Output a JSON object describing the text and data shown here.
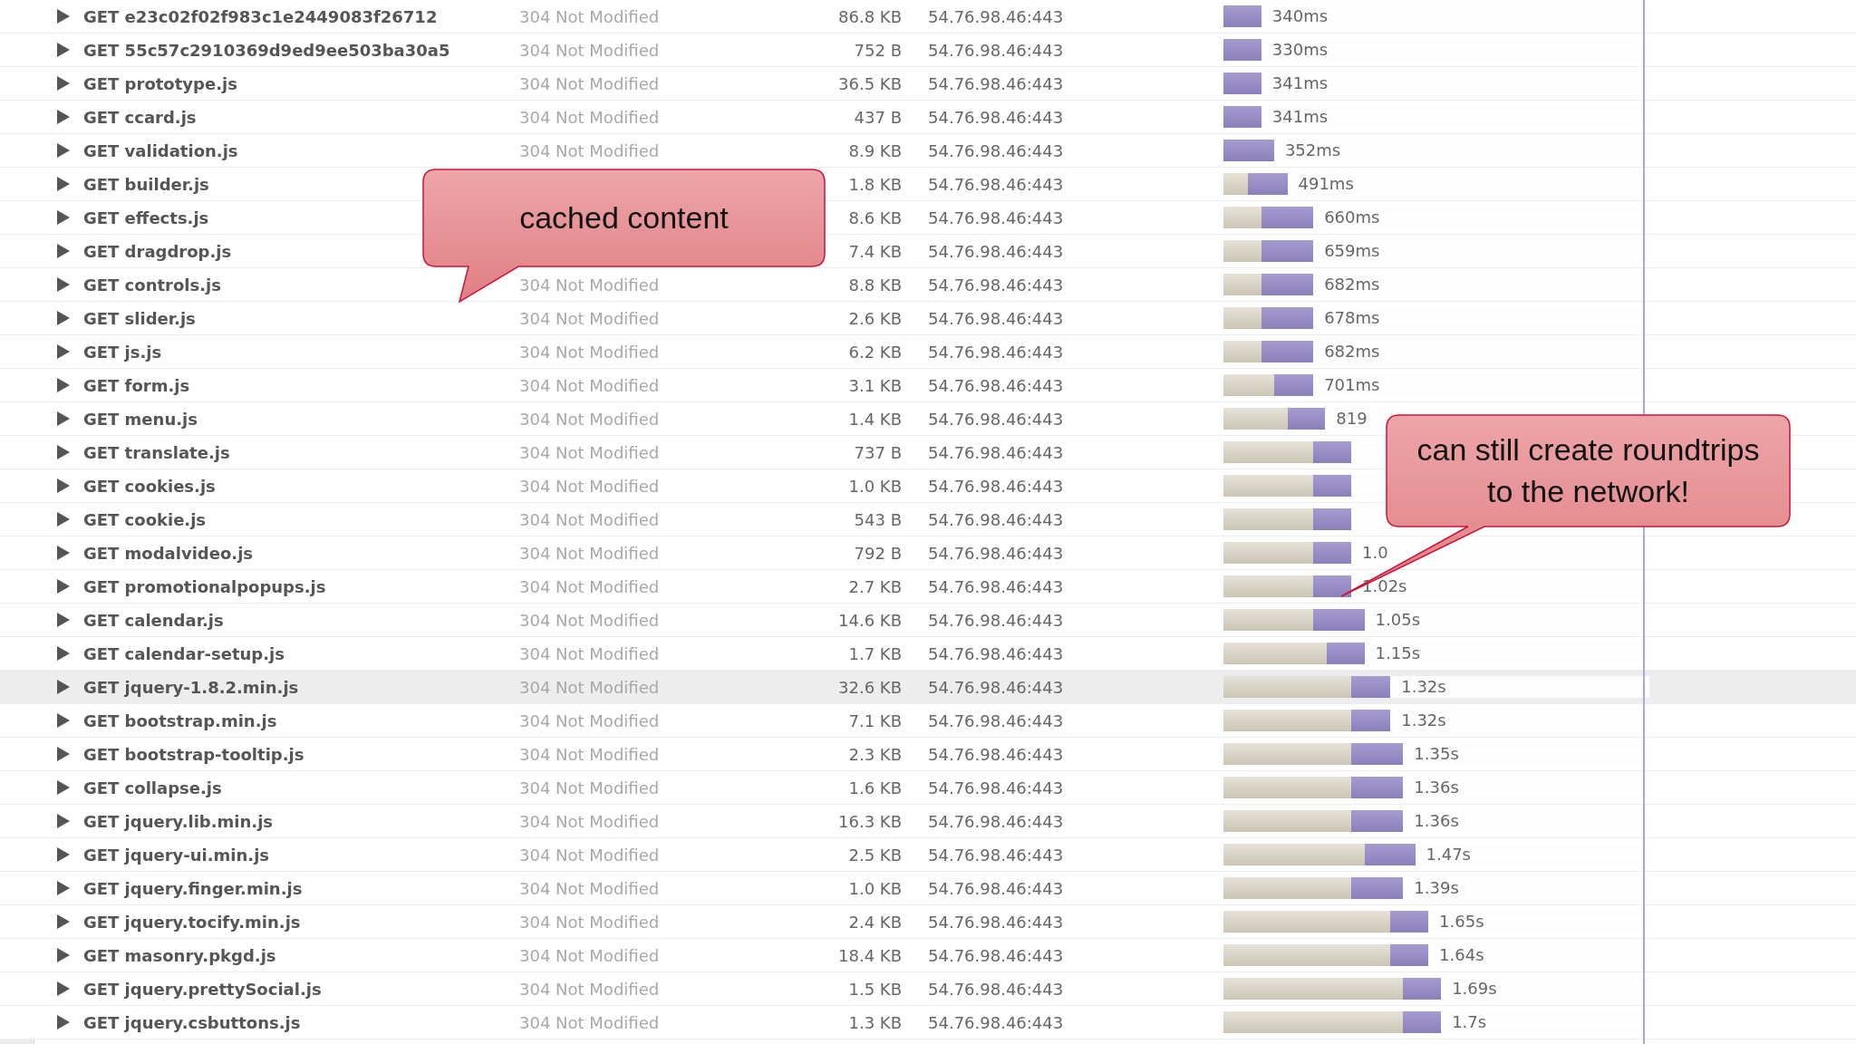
{
  "requests": [
    {
      "name": "GET e23c02f02f983c1e2449083f26712",
      "status": "304 Not Modified",
      "size": "86.8 KB",
      "remote": "54.76.98.46:443",
      "selected": false,
      "bar": {
        "level": 0.089
      },
      "time": "340ms"
    },
    {
      "name": "GET 55c57c2910369d9ed9ee503ba30a5",
      "status": "304 Not Modified",
      "size": "752 B",
      "remote": "54.76.98.46:443",
      "selected": false,
      "bar": {
        "level": 0.089
      },
      "time": "330ms"
    },
    {
      "name": "GET prototype.js",
      "status": "304 Not Modified",
      "size": "36.5 KB",
      "remote": "54.76.98.46:443",
      "selected": false,
      "bar": {
        "level": 0.089
      },
      "time": "341ms"
    },
    {
      "name": "GET ccard.js",
      "status": "304 Not Modified",
      "size": "437 B",
      "remote": "54.76.98.46:443",
      "selected": false,
      "bar": {
        "level": 0.089
      },
      "time": "341ms"
    },
    {
      "name": "GET validation.js",
      "status": "304 Not Modified",
      "size": "8.9 KB",
      "remote": "54.76.98.46:443",
      "selected": false,
      "bar": {
        "level": 0.119
      },
      "time": "352ms"
    },
    {
      "name": "GET builder.js",
      "size": "1.8 KB",
      "remote": "54.76.98.46:443",
      "selected": false,
      "wait": {
        "level": 0.058
      },
      "bar": {
        "level": 0.15
      },
      "time": "491ms"
    },
    {
      "name": "GET effects.js",
      "size": "8.6 KB",
      "remote": "54.76.98.46:443",
      "selected": false,
      "wait": {
        "level": 0.089
      },
      "bar": {
        "level": 0.211
      },
      "time": "660ms"
    },
    {
      "name": "GET dragdrop.js",
      "size": "7.4 KB",
      "remote": "54.76.98.46:443",
      "selected": false,
      "wait": {
        "level": 0.089
      },
      "bar": {
        "level": 0.211
      },
      "time": "659ms"
    },
    {
      "name": "GET controls.js",
      "status": "304 Not Modified",
      "size": "8.8 KB",
      "remote": "54.76.98.46:443",
      "selected": false,
      "wait": {
        "level": 0.089
      },
      "bar": {
        "level": 0.211
      },
      "time": "682ms"
    },
    {
      "name": "GET slider.js",
      "status": "304 Not Modified",
      "size": "2.6 KB",
      "remote": "54.76.98.46:443",
      "selected": false,
      "wait": {
        "level": 0.089
      },
      "bar": {
        "level": 0.211
      },
      "time": "678ms"
    },
    {
      "name": "GET js.js",
      "status": "304 Not Modified",
      "size": "6.2 KB",
      "remote": "54.76.98.46:443",
      "selected": false,
      "wait": {
        "level": 0.089
      },
      "bar": {
        "level": 0.211
      },
      "time": "682ms"
    },
    {
      "name": "GET form.js",
      "status": "304 Not Modified",
      "size": "3.1 KB",
      "remote": "54.76.98.46:443",
      "selected": false,
      "wait": {
        "level": 0.119
      },
      "bar": {
        "level": 0.211
      },
      "time": "701ms"
    },
    {
      "name": "GET menu.js",
      "status": "304 Not Modified",
      "size": "1.4 KB",
      "remote": "54.76.98.46:443",
      "selected": false,
      "wait": {
        "level": 0.15
      },
      "bar": {
        "level": 0.239
      },
      "time": "819"
    },
    {
      "name": "GET translate.js",
      "status": "304 Not Modified",
      "size": "737 B",
      "remote": "54.76.98.46:443",
      "selected": false,
      "wait": {
        "level": 0.211
      },
      "bar": {
        "level": 0.3
      }
    },
    {
      "name": "GET cookies.js",
      "status": "304 Not Modified",
      "size": "1.0 KB",
      "remote": "54.76.98.46:443",
      "selected": false,
      "wait": {
        "level": 0.211
      },
      "bar": {
        "level": 0.3
      }
    },
    {
      "name": "GET cookie.js",
      "status": "304 Not Modified",
      "size": "543 B",
      "remote": "54.76.98.46:443",
      "selected": false,
      "wait": {
        "level": 0.211
      },
      "bar": {
        "level": 0.3
      }
    },
    {
      "name": "GET modalvideo.js",
      "status": "304 Not Modified",
      "size": "792 B",
      "remote": "54.76.98.46:443",
      "selected": false,
      "wait": {
        "level": 0.211
      },
      "bar": {
        "level": 0.3
      },
      "time": "1.0"
    },
    {
      "name": "GET promotionalpopups.js",
      "status": "304 Not Modified",
      "size": "2.7 KB",
      "remote": "54.76.98.46:443",
      "selected": false,
      "wait": {
        "level": 0.211
      },
      "bar": {
        "level": 0.3
      },
      "time": "1.02s"
    },
    {
      "name": "GET calendar.js",
      "status": "304 Not Modified",
      "size": "14.6 KB",
      "remote": "54.76.98.46:443",
      "selected": false,
      "wait": {
        "level": 0.211
      },
      "bar": {
        "level": 0.331
      },
      "time": "1.05s"
    },
    {
      "name": "GET calendar-setup.js",
      "status": "304 Not Modified",
      "size": "1.7 KB",
      "remote": "54.76.98.46:443",
      "selected": false,
      "wait": {
        "level": 0.242
      },
      "bar": {
        "level": 0.331
      },
      "time": "1.15s"
    },
    {
      "name": "GET jquery-1.8.2.min.js",
      "status": "304 Not Modified",
      "size": "32.6 KB",
      "remote": "54.76.98.46:443",
      "selected": true,
      "wait": {
        "level": 0.3
      },
      "bar": {
        "level": 0.392
      },
      "time": "1.32s"
    },
    {
      "name": "GET bootstrap.min.js",
      "status": "304 Not Modified",
      "size": "7.1 KB",
      "remote": "54.76.98.46:443",
      "selected": false,
      "wait": {
        "level": 0.3
      },
      "bar": {
        "level": 0.392
      },
      "time": "1.32s"
    },
    {
      "name": "GET bootstrap-tooltip.js",
      "status": "304 Not Modified",
      "size": "2.3 KB",
      "remote": "54.76.98.46:443",
      "selected": false,
      "wait": {
        "level": 0.3
      },
      "bar": {
        "level": 0.422
      },
      "time": "1.35s"
    },
    {
      "name": "GET collapse.js",
      "status": "304 Not Modified",
      "size": "1.6 KB",
      "remote": "54.76.98.46:443",
      "selected": false,
      "wait": {
        "level": 0.3
      },
      "bar": {
        "level": 0.422
      },
      "time": "1.36s"
    },
    {
      "name": "GET jquery.lib.min.js",
      "status": "304 Not Modified",
      "size": "16.3 KB",
      "remote": "54.76.98.46:443",
      "selected": false,
      "wait": {
        "level": 0.3
      },
      "bar": {
        "level": 0.422
      },
      "time": "1.36s"
    },
    {
      "name": "GET jquery-ui.min.js",
      "status": "304 Not Modified",
      "size": "2.5 KB",
      "remote": "54.76.98.46:443",
      "selected": false,
      "wait": {
        "level": 0.331
      },
      "bar": {
        "level": 0.45
      },
      "time": "1.47s"
    },
    {
      "name": "GET jquery.finger.min.js",
      "status": "304 Not Modified",
      "size": "1.0 KB",
      "remote": "54.76.98.46:443",
      "selected": false,
      "wait": {
        "level": 0.3
      },
      "bar": {
        "level": 0.422
      },
      "time": "1.39s"
    },
    {
      "name": "GET jquery.tocify.min.js",
      "status": "304 Not Modified",
      "size": "2.4 KB",
      "remote": "54.76.98.46:443",
      "selected": false,
      "wait": {
        "level": 0.392
      },
      "bar": {
        "level": 0.481
      },
      "time": "1.65s"
    },
    {
      "name": "GET masonry.pkgd.js",
      "status": "304 Not Modified",
      "size": "18.4 KB",
      "remote": "54.76.98.46:443",
      "selected": false,
      "wait": {
        "level": 0.392
      },
      "bar": {
        "level": 0.481
      },
      "time": "1.64s"
    },
    {
      "name": "GET jquery.prettySocial.js",
      "status": "304 Not Modified",
      "size": "1.5 KB",
      "remote": "54.76.98.46:443",
      "selected": false,
      "wait": {
        "level": 0.422
      },
      "bar": {
        "level": 0.511
      },
      "time": "1.69s"
    },
    {
      "name": "GET jquery.csbuttons.js",
      "status": "304 Not Modified",
      "size": "1.3 KB",
      "remote": "54.76.98.46:443",
      "selected": false,
      "wait": {
        "level": 0.422
      },
      "bar": {
        "level": 0.511
      },
      "time": "1.7s"
    }
  ],
  "callouts": [
    {
      "text": "cached content"
    },
    {
      "text": "can still create roundtrips to the network!"
    }
  ]
}
